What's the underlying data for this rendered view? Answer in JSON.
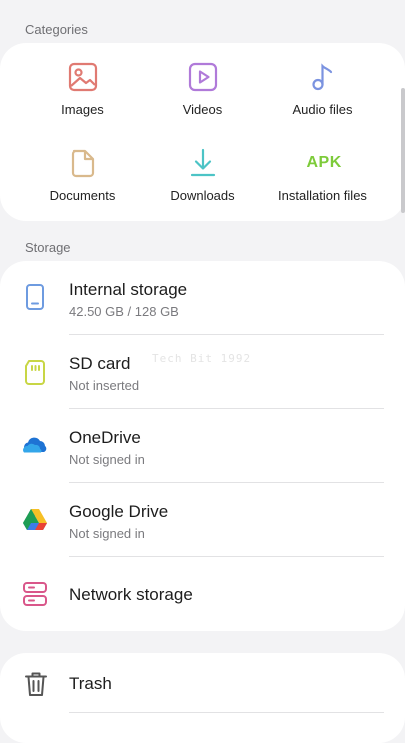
{
  "categories": {
    "title": "Categories",
    "items": [
      {
        "label": "Images",
        "icon": "image-icon",
        "color": "#e07a72"
      },
      {
        "label": "Videos",
        "icon": "video-icon",
        "color": "#b07ad9"
      },
      {
        "label": "Audio files",
        "icon": "music-note-icon",
        "color": "#7b93e0"
      },
      {
        "label": "Documents",
        "icon": "document-icon",
        "color": "#d9b98c"
      },
      {
        "label": "Downloads",
        "icon": "download-icon",
        "color": "#4cc4c6"
      },
      {
        "label": "Installation files",
        "icon": "apk-icon",
        "icon_text": "APK",
        "color": "#7dcb3a"
      }
    ]
  },
  "storage": {
    "title": "Storage",
    "items": [
      {
        "name": "Internal storage",
        "detail": "42.50 GB / 128 GB",
        "icon": "phone-icon",
        "color": "#6e9be0"
      },
      {
        "name": "SD card",
        "detail": "Not inserted",
        "icon": "sd-card-icon",
        "color": "#c8d645"
      },
      {
        "name": "OneDrive",
        "detail": "Not signed in",
        "icon": "onedrive-icon",
        "color": "#1e73d4"
      },
      {
        "name": "Google Drive",
        "detail": "Not signed in",
        "icon": "google-drive-icon"
      },
      {
        "name": "Network storage",
        "icon": "server-icon",
        "color": "#d9578a"
      }
    ]
  },
  "other": {
    "items": [
      {
        "name": "Trash",
        "icon": "trash-icon",
        "color": "#555555"
      }
    ]
  },
  "watermark": "Tech Bit 1992"
}
